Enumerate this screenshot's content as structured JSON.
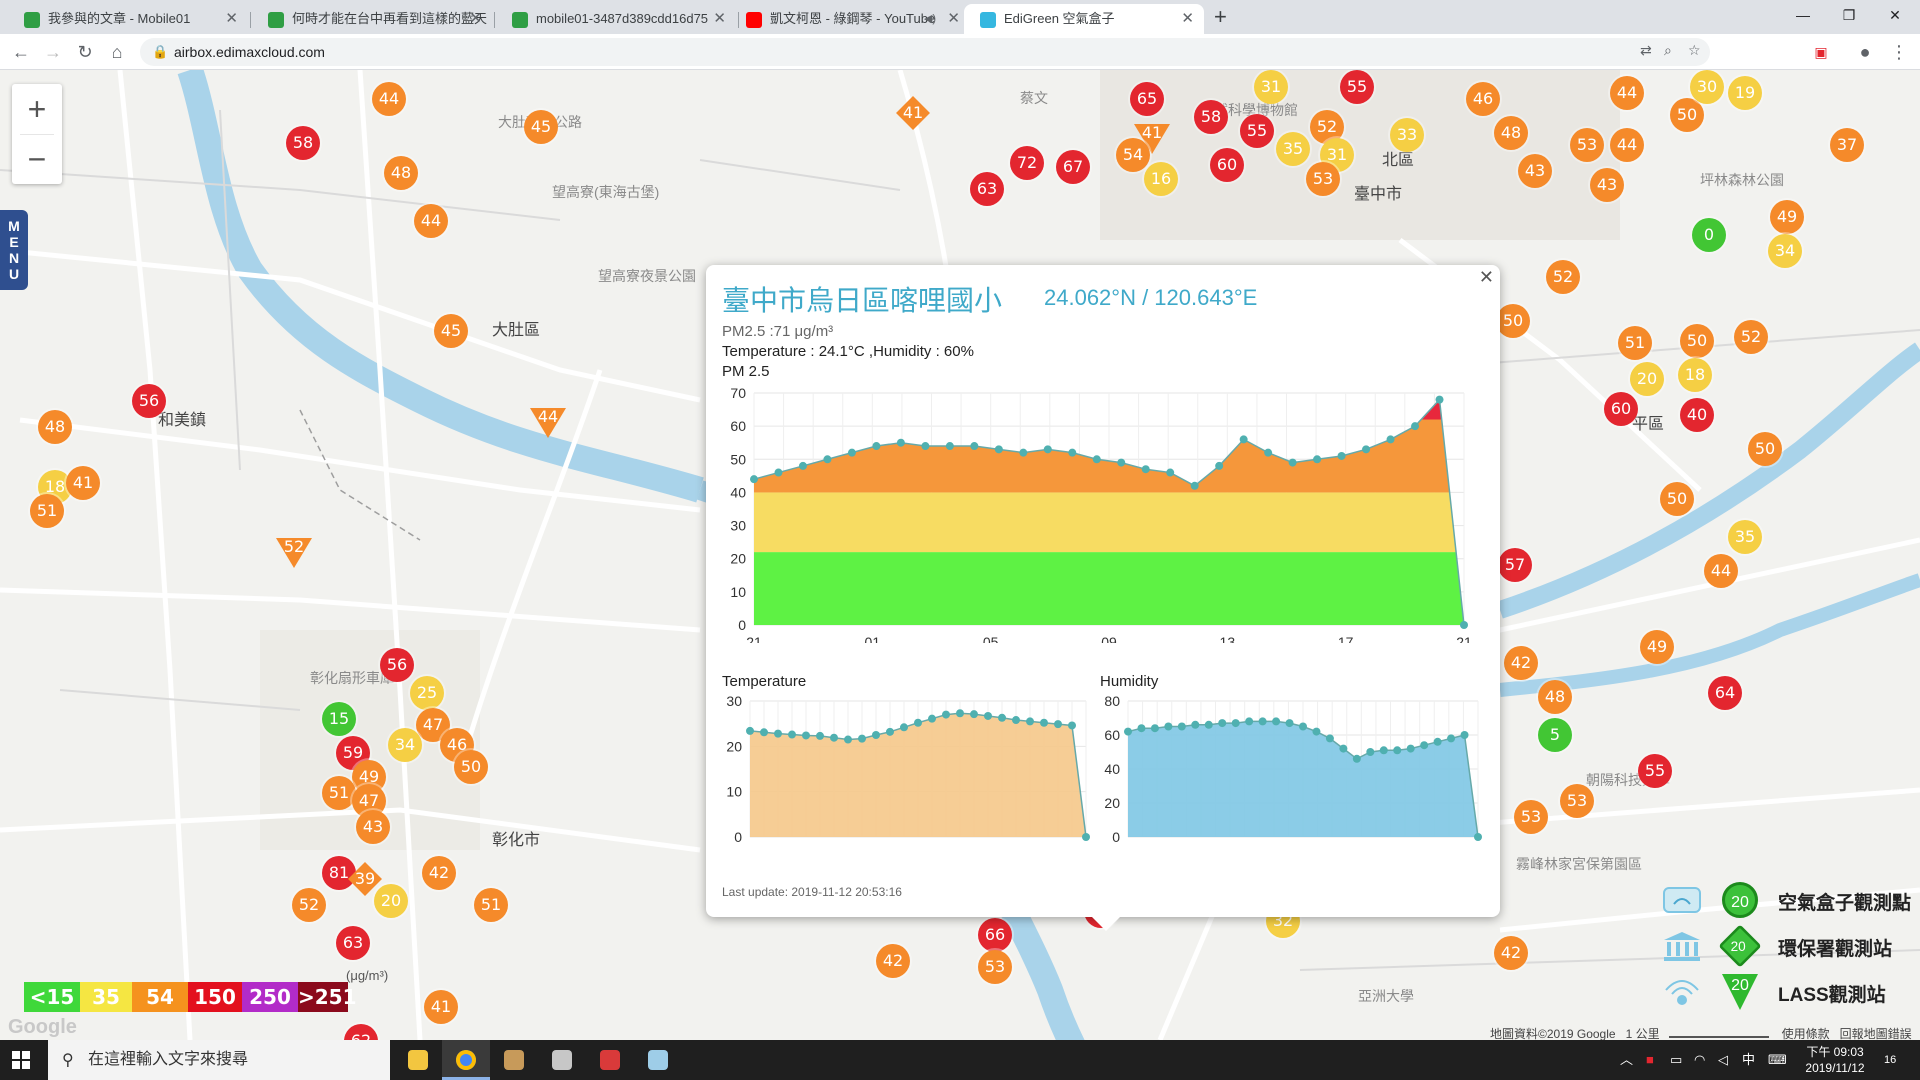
{
  "browser": {
    "tabs": [
      {
        "title": "我參與的文章 - Mobile01",
        "icon_color": "#2f9e44"
      },
      {
        "title": "何時才能在台中再看到這樣的藍天",
        "icon_color": "#2f9e44"
      },
      {
        "title": "mobile01-3487d389cdd16d75",
        "icon_color": "#2f9e44"
      },
      {
        "title": "凱文柯恩 - 綠鋼琴 - YouTube",
        "icon_color": "#ff0000"
      },
      {
        "title": "EdiGreen 空氣盒子",
        "icon_color": "#35b7e0"
      }
    ],
    "active_tab": 4,
    "url": "airbox.edimaxcloud.com"
  },
  "map": {
    "labels": [
      {
        "text": "大肚區",
        "cls": "big",
        "x": 492,
        "y": 246
      },
      {
        "text": "和美鎮",
        "cls": "big",
        "x": 158,
        "y": 336
      },
      {
        "text": "彰化市",
        "cls": "big",
        "x": 492,
        "y": 756
      },
      {
        "text": "望高寮(東海古堡)",
        "cls": "poi",
        "x": 552,
        "y": 112
      },
      {
        "text": "望高寮夜景公園",
        "cls": "poi",
        "x": 598,
        "y": 196
      },
      {
        "text": "大肚環保公路",
        "cls": "poi",
        "x": 498,
        "y": 42
      },
      {
        "text": "彰化扇形車庫",
        "cls": "poi",
        "x": 310,
        "y": 598
      },
      {
        "text": "霧峰林家宮保第園區",
        "cls": "poi",
        "x": 1516,
        "y": 784
      },
      {
        "text": "亞洲大學",
        "cls": "poi",
        "x": 1358,
        "y": 916
      },
      {
        "text": "朝陽科技大學",
        "cls": "poi",
        "x": 1586,
        "y": 700
      },
      {
        "text": "坪林森林公園",
        "cls": "poi",
        "x": 1700,
        "y": 100
      },
      {
        "text": "自然科學博物館",
        "cls": "poi",
        "x": 1200,
        "y": 30
      },
      {
        "text": "北區",
        "cls": "big",
        "x": 1382,
        "y": 76
      },
      {
        "text": "平區",
        "cls": "big",
        "x": 1632,
        "y": 340
      },
      {
        "text": "臺中市",
        "cls": "big",
        "x": 1354,
        "y": 110
      },
      {
        "text": "蔡文",
        "cls": "poi",
        "x": 1020,
        "y": 18
      }
    ],
    "markers": [
      {
        "v": "44",
        "c": "or",
        "x": 372,
        "y": 12
      },
      {
        "v": "58",
        "c": "rd",
        "x": 286,
        "y": 56
      },
      {
        "v": "48",
        "c": "or",
        "x": 384,
        "y": 86
      },
      {
        "v": "45",
        "c": "or",
        "x": 524,
        "y": 40
      },
      {
        "v": "44",
        "c": "or",
        "x": 414,
        "y": 134
      },
      {
        "v": "45",
        "c": "or",
        "x": 434,
        "y": 244
      },
      {
        "v": "56",
        "c": "rd",
        "x": 132,
        "y": 314
      },
      {
        "v": "48",
        "c": "or",
        "x": 38,
        "y": 340
      },
      {
        "v": "18",
        "c": "ye",
        "x": 38,
        "y": 400
      },
      {
        "v": "41",
        "c": "or",
        "x": 66,
        "y": 396
      },
      {
        "v": "51",
        "c": "or",
        "x": 30,
        "y": 424
      },
      {
        "v": "44",
        "c": "tri",
        "x": 530,
        "y": 338
      },
      {
        "v": "52",
        "c": "tri",
        "x": 276,
        "y": 468
      },
      {
        "v": "56",
        "c": "rd",
        "x": 380,
        "y": 578
      },
      {
        "v": "25",
        "c": "ye",
        "x": 410,
        "y": 606
      },
      {
        "v": "15",
        "c": "gr",
        "x": 322,
        "y": 632
      },
      {
        "v": "47",
        "c": "or",
        "x": 416,
        "y": 638
      },
      {
        "v": "34",
        "c": "ye",
        "x": 388,
        "y": 658
      },
      {
        "v": "46",
        "c": "or",
        "x": 440,
        "y": 658
      },
      {
        "v": "59",
        "c": "rd",
        "x": 336,
        "y": 666
      },
      {
        "v": "49",
        "c": "or",
        "x": 352,
        "y": 690
      },
      {
        "v": "50",
        "c": "or",
        "x": 454,
        "y": 680
      },
      {
        "v": "51",
        "c": "or",
        "x": 322,
        "y": 706
      },
      {
        "v": "47",
        "c": "or",
        "x": 352,
        "y": 714
      },
      {
        "v": "43",
        "c": "or",
        "x": 356,
        "y": 740
      },
      {
        "v": "81",
        "c": "rd",
        "x": 322,
        "y": 786
      },
      {
        "v": "39",
        "c": "dia",
        "x": 348,
        "y": 792
      },
      {
        "v": "20",
        "c": "ye",
        "x": 374,
        "y": 814
      },
      {
        "v": "42",
        "c": "or",
        "x": 422,
        "y": 786
      },
      {
        "v": "52",
        "c": "or",
        "x": 292,
        "y": 818
      },
      {
        "v": "51",
        "c": "or",
        "x": 474,
        "y": 818
      },
      {
        "v": "63",
        "c": "rd",
        "x": 336,
        "y": 856
      },
      {
        "v": "41",
        "c": "or",
        "x": 424,
        "y": 920
      },
      {
        "v": "62",
        "c": "rd",
        "x": 344,
        "y": 954
      },
      {
        "v": "41",
        "c": "dia",
        "x": 896,
        "y": 26
      },
      {
        "v": "65",
        "c": "rd",
        "x": 1130,
        "y": 12
      },
      {
        "v": "58",
        "c": "rd",
        "x": 1194,
        "y": 30
      },
      {
        "v": "41",
        "c": "tri",
        "x": 1134,
        "y": 54
      },
      {
        "v": "55",
        "c": "rd",
        "x": 1240,
        "y": 44
      },
      {
        "v": "52",
        "c": "or",
        "x": 1310,
        "y": 40
      },
      {
        "v": "72",
        "c": "rd",
        "x": 1010,
        "y": 76
      },
      {
        "v": "67",
        "c": "rd",
        "x": 1056,
        "y": 80
      },
      {
        "v": "54",
        "c": "or",
        "x": 1116,
        "y": 68
      },
      {
        "v": "60",
        "c": "rd",
        "x": 1210,
        "y": 78
      },
      {
        "v": "35",
        "c": "ye",
        "x": 1276,
        "y": 62
      },
      {
        "v": "31",
        "c": "ye",
        "x": 1320,
        "y": 68
      },
      {
        "v": "16",
        "c": "ye",
        "x": 1144,
        "y": 92
      },
      {
        "v": "63",
        "c": "rd",
        "x": 970,
        "y": 102
      },
      {
        "v": "53",
        "c": "or",
        "x": 1306,
        "y": 92
      },
      {
        "v": "33",
        "c": "ye",
        "x": 1390,
        "y": 48
      },
      {
        "v": "31",
        "c": "ye",
        "x": 1254,
        "y": 0
      },
      {
        "v": "55",
        "c": "rd",
        "x": 1340,
        "y": 0
      },
      {
        "v": "46",
        "c": "or",
        "x": 1466,
        "y": 12
      },
      {
        "v": "48",
        "c": "or",
        "x": 1494,
        "y": 46
      },
      {
        "v": "43",
        "c": "or",
        "x": 1518,
        "y": 84
      },
      {
        "v": "43",
        "c": "or",
        "x": 1590,
        "y": 98
      },
      {
        "v": "53",
        "c": "or",
        "x": 1570,
        "y": 58
      },
      {
        "v": "44",
        "c": "or",
        "x": 1610,
        "y": 58
      },
      {
        "v": "44",
        "c": "or",
        "x": 1610,
        "y": 6
      },
      {
        "v": "50",
        "c": "or",
        "x": 1670,
        "y": 28
      },
      {
        "v": "30",
        "c": "ye",
        "x": 1690,
        "y": 0
      },
      {
        "v": "19",
        "c": "ye",
        "x": 1728,
        "y": 6
      },
      {
        "v": "37",
        "c": "or",
        "x": 1830,
        "y": 58
      },
      {
        "v": "0",
        "c": "gr",
        "x": 1692,
        "y": 148
      },
      {
        "v": "49",
        "c": "or",
        "x": 1770,
        "y": 130
      },
      {
        "v": "34",
        "c": "ye",
        "x": 1768,
        "y": 164
      },
      {
        "v": "52",
        "c": "or",
        "x": 1546,
        "y": 190
      },
      {
        "v": "50",
        "c": "or",
        "x": 1496,
        "y": 234
      },
      {
        "v": "51",
        "c": "or",
        "x": 1618,
        "y": 256
      },
      {
        "v": "50",
        "c": "or",
        "x": 1680,
        "y": 254
      },
      {
        "v": "52",
        "c": "or",
        "x": 1734,
        "y": 250
      },
      {
        "v": "20",
        "c": "ye",
        "x": 1630,
        "y": 292
      },
      {
        "v": "18",
        "c": "ye",
        "x": 1678,
        "y": 288
      },
      {
        "v": "60",
        "c": "rd",
        "x": 1604,
        "y": 322
      },
      {
        "v": "40",
        "c": "rd",
        "x": 1680,
        "y": 328
      },
      {
        "v": "50",
        "c": "or",
        "x": 1748,
        "y": 362
      },
      {
        "v": "50",
        "c": "or",
        "x": 1660,
        "y": 412
      },
      {
        "v": "35",
        "c": "ye",
        "x": 1728,
        "y": 450
      },
      {
        "v": "44",
        "c": "or",
        "x": 1704,
        "y": 484
      },
      {
        "v": "57",
        "c": "rd",
        "x": 1498,
        "y": 478
      },
      {
        "v": "49",
        "c": "or",
        "x": 1640,
        "y": 560
      },
      {
        "v": "42",
        "c": "or",
        "x": 1504,
        "y": 576
      },
      {
        "v": "48",
        "c": "or",
        "x": 1538,
        "y": 610
      },
      {
        "v": "64",
        "c": "rd",
        "x": 1708,
        "y": 606
      },
      {
        "v": "5",
        "c": "gr",
        "x": 1538,
        "y": 648
      },
      {
        "v": "55",
        "c": "rd",
        "x": 1638,
        "y": 684
      },
      {
        "v": "53",
        "c": "or",
        "x": 1560,
        "y": 714
      },
      {
        "v": "53",
        "c": "or",
        "x": 1514,
        "y": 730
      },
      {
        "v": "32",
        "c": "ye",
        "x": 1266,
        "y": 834
      },
      {
        "v": "42",
        "c": "or",
        "x": 1494,
        "y": 866
      },
      {
        "v": "42",
        "c": "or",
        "x": 876,
        "y": 874
      },
      {
        "v": "66",
        "c": "rd",
        "x": 978,
        "y": 848
      },
      {
        "v": "53",
        "c": "or",
        "x": 978,
        "y": 880
      },
      {
        "v": "71",
        "c": "rd",
        "x": 1084,
        "y": 824
      }
    ],
    "legend_scale": [
      {
        "label": "<15",
        "color": "#3fd83a"
      },
      {
        "label": "35",
        "color": "#f5e642"
      },
      {
        "label": "54",
        "color": "#f5921e"
      },
      {
        "label": "150",
        "color": "#e3101e"
      },
      {
        "label": "250",
        "color": "#b22bc8"
      },
      {
        "label": ">251",
        "color": "#8b0a1c"
      }
    ],
    "unit": "(μg/m³)",
    "legend_types": [
      {
        "label": "空氣盒子觀測點",
        "badge": "20"
      },
      {
        "label": "環保署觀測站",
        "badge": "20"
      },
      {
        "label": "LASS觀測站",
        "badge": "20"
      }
    ],
    "footer": [
      "地圖資料©2019 Google",
      "1 公里",
      "使用條款",
      "回報地圖錯誤"
    ],
    "google_logo": "Google",
    "menu_label": "MENU"
  },
  "popup": {
    "title": "臺中市烏日區喀哩國小",
    "coord": "24.062°N / 120.643°E",
    "pm25_text": "PM2.5 :71 μg/m³",
    "temp_hum_text": "Temperature : 24.1°C ,Humidity : 60%",
    "pm_chart_label": "PM 2.5",
    "temp_chart_label": "Temperature",
    "hum_chart_label": "Humidity",
    "last_update": "Last update: 2019-11-12 20:53:16"
  },
  "chart_data": [
    {
      "type": "area",
      "title": "PM 2.5",
      "x_ticks": [
        "21",
        "01",
        "05",
        "09",
        "13",
        "17",
        "21"
      ],
      "ylim": [
        0,
        70
      ],
      "y_ticks": [
        0,
        10,
        20,
        30,
        40,
        50,
        60,
        70
      ],
      "values": [
        44,
        46,
        48,
        50,
        52,
        54,
        55,
        54,
        54,
        54,
        53,
        52,
        53,
        52,
        50,
        49,
        47,
        46,
        42,
        48,
        56,
        52,
        49,
        50,
        51,
        53,
        56,
        60,
        68,
        0
      ],
      "bands": [
        {
          "from": 0,
          "to": 22,
          "color": "#5ef244"
        },
        {
          "from": 22,
          "to": 40,
          "color": "#f7dc62"
        },
        {
          "from": 40,
          "to": 62,
          "color": "#f5973b"
        },
        {
          "from": 62,
          "to": 70,
          "color": "#e8283c"
        }
      ]
    },
    {
      "type": "area",
      "title": "Temperature",
      "ylim": [
        0,
        30
      ],
      "y_ticks": [
        0,
        10,
        20,
        30
      ],
      "values": [
        23.4,
        23.1,
        22.8,
        22.6,
        22.4,
        22.3,
        21.9,
        21.5,
        21.7,
        22.5,
        23.2,
        24.2,
        25.2,
        26.1,
        27.0,
        27.3,
        27.1,
        26.7,
        26.3,
        25.8,
        25.5,
        25.2,
        24.9,
        24.6,
        0
      ],
      "color": "#f5c88a"
    },
    {
      "type": "area",
      "title": "Humidity",
      "ylim": [
        0,
        80
      ],
      "y_ticks": [
        0,
        20,
        40,
        60,
        80
      ],
      "values": [
        62,
        64,
        64,
        65,
        65,
        66,
        66,
        67,
        67,
        68,
        68,
        68,
        67,
        65,
        62,
        58,
        52,
        46,
        50,
        51,
        51,
        52,
        54,
        56,
        58,
        60,
        0
      ],
      "color": "#7ec6e4"
    }
  ],
  "taskbar": {
    "search_placeholder": "在這裡輸入文字來搜尋",
    "time": "下午 09:03",
    "date": "2019/11/12",
    "ime": "中",
    "notif_count": "16"
  }
}
